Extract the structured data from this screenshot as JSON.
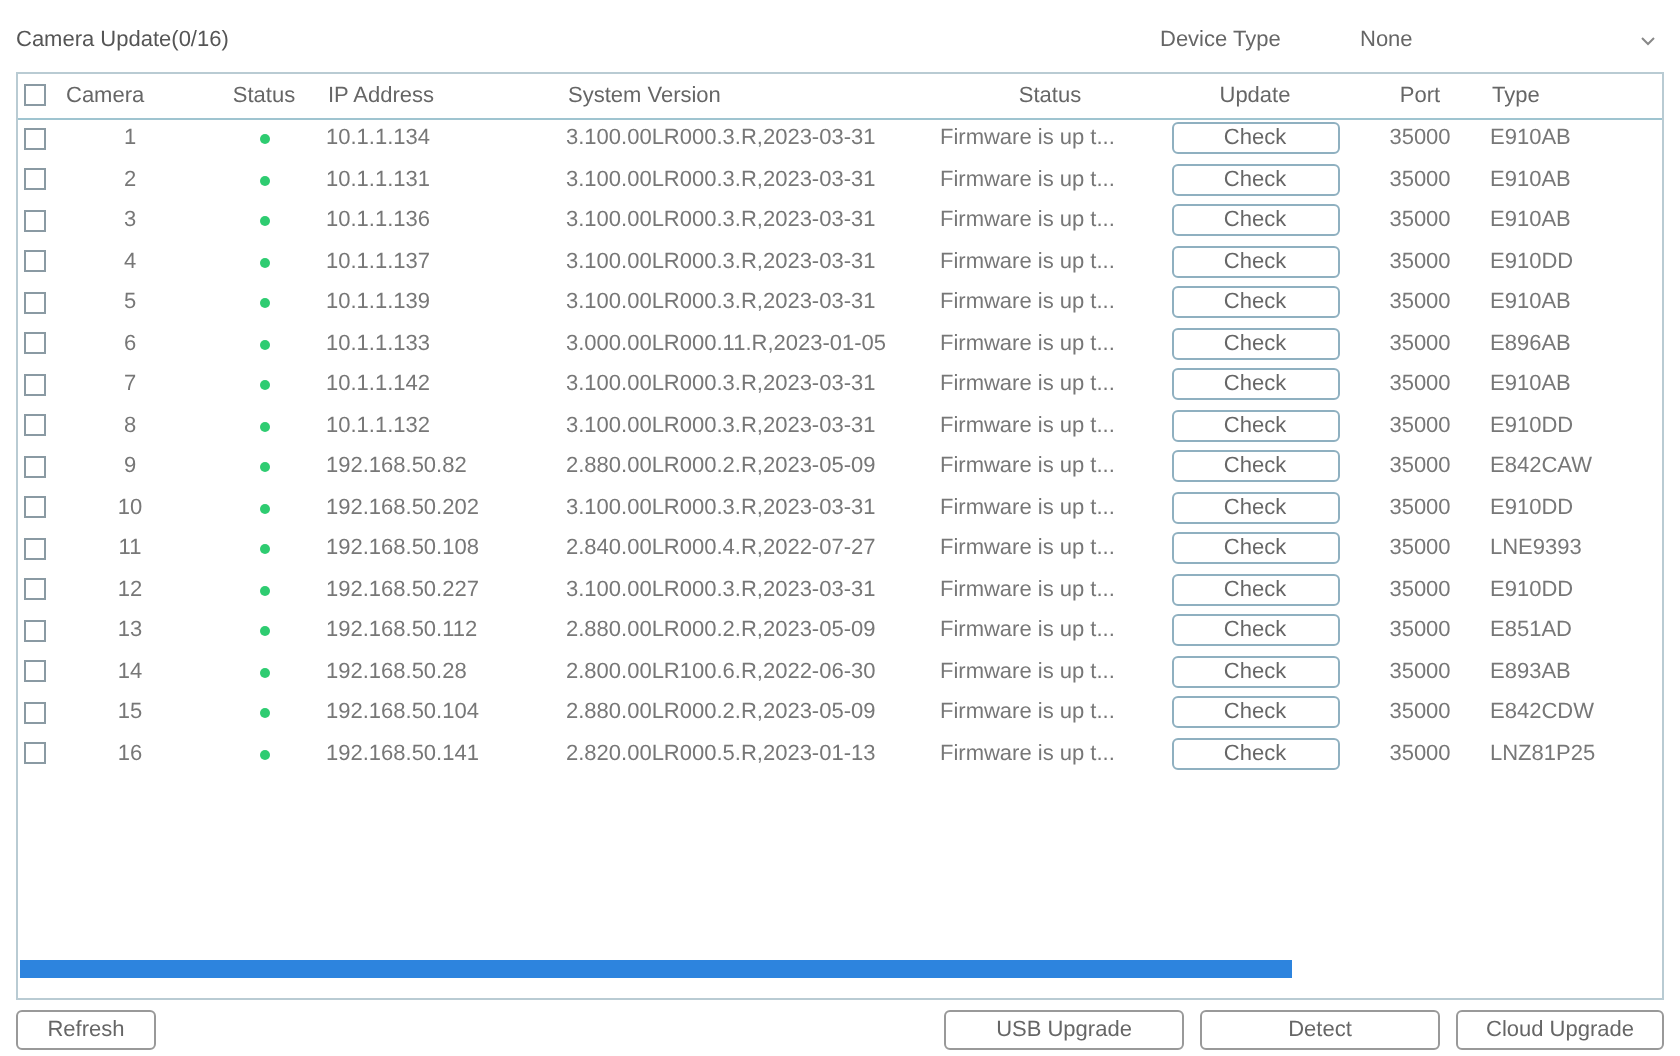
{
  "title": "Camera Update(0/16)",
  "device_type": {
    "label": "Device Type",
    "value": "None"
  },
  "table": {
    "select_all_checked": false,
    "columns": [
      "Camera",
      "Status",
      "IP Address",
      "System Version",
      "Status",
      "Update",
      "Port",
      "Type"
    ],
    "rows": [
      {
        "checked": false,
        "camera": "1",
        "online": true,
        "ip": "10.1.1.134",
        "version": "3.100.00LR000.3.R,2023-03-31",
        "status": "Firmware is up t...",
        "update": "Check",
        "port": "35000",
        "type": "E910AB"
      },
      {
        "checked": false,
        "camera": "2",
        "online": true,
        "ip": "10.1.1.131",
        "version": "3.100.00LR000.3.R,2023-03-31",
        "status": "Firmware is up t...",
        "update": "Check",
        "port": "35000",
        "type": "E910AB"
      },
      {
        "checked": false,
        "camera": "3",
        "online": true,
        "ip": "10.1.1.136",
        "version": "3.100.00LR000.3.R,2023-03-31",
        "status": "Firmware is up t...",
        "update": "Check",
        "port": "35000",
        "type": "E910AB"
      },
      {
        "checked": false,
        "camera": "4",
        "online": true,
        "ip": "10.1.1.137",
        "version": "3.100.00LR000.3.R,2023-03-31",
        "status": "Firmware is up t...",
        "update": "Check",
        "port": "35000",
        "type": "E910DD"
      },
      {
        "checked": false,
        "camera": "5",
        "online": true,
        "ip": "10.1.1.139",
        "version": "3.100.00LR000.3.R,2023-03-31",
        "status": "Firmware is up t...",
        "update": "Check",
        "port": "35000",
        "type": "E910AB"
      },
      {
        "checked": false,
        "camera": "6",
        "online": true,
        "ip": "10.1.1.133",
        "version": "3.000.00LR000.11.R,2023-01-05",
        "status": "Firmware is up t...",
        "update": "Check",
        "port": "35000",
        "type": "E896AB"
      },
      {
        "checked": false,
        "camera": "7",
        "online": true,
        "ip": "10.1.1.142",
        "version": "3.100.00LR000.3.R,2023-03-31",
        "status": "Firmware is up t...",
        "update": "Check",
        "port": "35000",
        "type": "E910AB"
      },
      {
        "checked": false,
        "camera": "8",
        "online": true,
        "ip": "10.1.1.132",
        "version": "3.100.00LR000.3.R,2023-03-31",
        "status": "Firmware is up t...",
        "update": "Check",
        "port": "35000",
        "type": "E910DD"
      },
      {
        "checked": false,
        "camera": "9",
        "online": true,
        "ip": "192.168.50.82",
        "version": "2.880.00LR000.2.R,2023-05-09",
        "status": "Firmware is up t...",
        "update": "Check",
        "port": "35000",
        "type": "E842CAW"
      },
      {
        "checked": false,
        "camera": "10",
        "online": true,
        "ip": "192.168.50.202",
        "version": "3.100.00LR000.3.R,2023-03-31",
        "status": "Firmware is up t...",
        "update": "Check",
        "port": "35000",
        "type": "E910DD"
      },
      {
        "checked": false,
        "camera": "11",
        "online": true,
        "ip": "192.168.50.108",
        "version": "2.840.00LR000.4.R,2022-07-27",
        "status": "Firmware is up t...",
        "update": "Check",
        "port": "35000",
        "type": "LNE9393"
      },
      {
        "checked": false,
        "camera": "12",
        "online": true,
        "ip": "192.168.50.227",
        "version": "3.100.00LR000.3.R,2023-03-31",
        "status": "Firmware is up t...",
        "update": "Check",
        "port": "35000",
        "type": "E910DD"
      },
      {
        "checked": false,
        "camera": "13",
        "online": true,
        "ip": "192.168.50.112",
        "version": "2.880.00LR000.2.R,2023-05-09",
        "status": "Firmware is up t...",
        "update": "Check",
        "port": "35000",
        "type": "E851AD"
      },
      {
        "checked": false,
        "camera": "14",
        "online": true,
        "ip": "192.168.50.28",
        "version": "2.800.00LR100.6.R,2022-06-30",
        "status": "Firmware is up t...",
        "update": "Check",
        "port": "35000",
        "type": "E893AB"
      },
      {
        "checked": false,
        "camera": "15",
        "online": true,
        "ip": "192.168.50.104",
        "version": "2.880.00LR000.2.R,2023-05-09",
        "status": "Firmware is up t...",
        "update": "Check",
        "port": "35000",
        "type": "E842CDW"
      },
      {
        "checked": false,
        "camera": "16",
        "online": true,
        "ip": "192.168.50.141",
        "version": "2.820.00LR000.5.R,2023-01-13",
        "status": "Firmware is up t...",
        "update": "Check",
        "port": "35000",
        "type": "LNZ81P25"
      }
    ]
  },
  "buttons_left": [
    "Refresh"
  ],
  "buttons_right": [
    "USB Upgrade",
    "Detect",
    "Cloud Upgrade"
  ]
}
